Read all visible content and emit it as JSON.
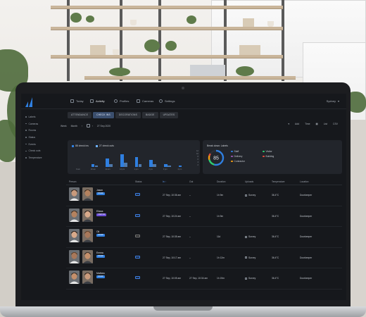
{
  "app": {
    "nav": [
      {
        "label": "Today",
        "icon": "calendar-icon",
        "active": false
      },
      {
        "label": "Activity",
        "icon": "activity-icon",
        "active": true
      },
      {
        "label": "Profiles",
        "icon": "user-icon",
        "active": false
      },
      {
        "label": "Cameras",
        "icon": "camera-icon",
        "active": false
      },
      {
        "label": "Settings",
        "icon": "gear-icon",
        "active": false
      }
    ],
    "location": "Sydney"
  },
  "sidebar": {
    "items": [
      "Labels",
      "Cameras",
      "Rooms",
      "Status",
      "Events",
      "Check outs",
      "Temperature"
    ]
  },
  "tabs": [
    "ATTENDANCE",
    "CHECK INS",
    "DECORATIONS",
    "BADGE",
    "UPDATES"
  ],
  "filters": {
    "view_label": "Week",
    "period_label": "Month",
    "date": "27 Sep 2020",
    "right": [
      "Add",
      "Time",
      "List",
      "CSV"
    ]
  },
  "chart_card": {
    "legend": [
      {
        "label": "88 check ins",
        "color": "#2f7fe0"
      },
      {
        "label": "27 check outs",
        "color": "#6db0ff"
      }
    ],
    "x_labels": [
      "9 am",
      "10 am",
      "11 am",
      "12 pm",
      "1 pm",
      "2 pm",
      "3 pm",
      "4 pm"
    ],
    "y_labels": [
      "12",
      "10",
      "8",
      "6",
      "4",
      "2"
    ]
  },
  "chart_data": {
    "type": "bar",
    "categories": [
      "9 am",
      "10 am",
      "11 am",
      "12 pm",
      "1 pm",
      "2 pm",
      "3 pm",
      "4 pm"
    ],
    "series": [
      {
        "name": "88 check ins",
        "values": [
          0,
          2,
          6,
          9,
          7,
          5,
          2,
          1
        ]
      },
      {
        "name": "27 check outs",
        "values": [
          0,
          1,
          2,
          3,
          2,
          2,
          1,
          0
        ]
      }
    ],
    "ylim": [
      0,
      12
    ]
  },
  "breakdown_card": {
    "title": "Break down: Labels",
    "score": "85",
    "legend": [
      {
        "label": "Staff",
        "color": "#2f7fe0"
      },
      {
        "label": "Visitor",
        "color": "#2ecc71"
      },
      {
        "label": "Delivery",
        "color": "#9b59b6"
      },
      {
        "label": "Building",
        "color": "#e74c3c"
      },
      {
        "label": "Contractor",
        "color": "#f39c12"
      }
    ]
  },
  "table": {
    "headers": [
      "Person",
      "Status",
      "In",
      "Out",
      "Duration",
      "Uploads",
      "Temperature",
      "Location"
    ],
    "rows": [
      {
        "name": "Jason",
        "badge": "STAFF",
        "badge_color": "blue",
        "status": "blue",
        "in": "27 Sep, 10:36 am",
        "out": "–",
        "duration": "1h 9m",
        "uploads": "Survey",
        "temp": "36.4°C",
        "location": "Doorkeeper"
      },
      {
        "name": "Eliana",
        "badge": "VISITOR",
        "badge_color": "purple",
        "status": "blue",
        "in": "27 Sep, 10:24 am",
        "out": "–",
        "duration": "1h 9m",
        "uploads": "",
        "temp": "36.4°C",
        "location": "Doorkeeper"
      },
      {
        "name": "Oli",
        "badge": "STAFF",
        "badge_color": "blue",
        "status": "grey",
        "in": "27 Sep, 10:35 am",
        "out": "–",
        "duration": "11d",
        "uploads": "Survey",
        "temp": "36.4°C",
        "location": "Doorkeeper"
      },
      {
        "name": "Emma",
        "badge": "STAFF",
        "badge_color": "blue",
        "status": "blue",
        "in": "27 Sep, 10:17 am",
        "out": "–",
        "duration": "1h 12m",
        "uploads": "Survey",
        "temp": "36.4°C",
        "location": "Doorkeeper"
      },
      {
        "name": "Mathew",
        "badge": "STAFF",
        "badge_color": "blue",
        "status": "blue",
        "in": "27 Sep, 10:05 am",
        "out": "27 Sep, 10:34 am",
        "duration": "1h 19m",
        "uploads": "Survey",
        "temp": "36.4°C",
        "location": "Doorkeeper"
      }
    ]
  }
}
